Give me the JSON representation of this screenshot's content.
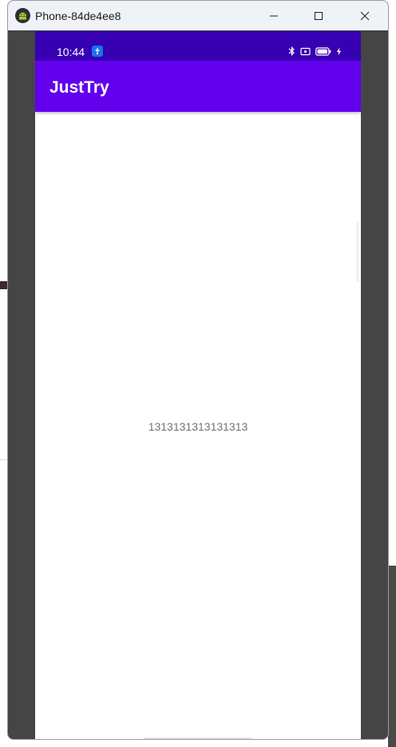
{
  "window": {
    "title": "Phone-84de4ee8",
    "buttons": [
      "minimize",
      "maximize",
      "close"
    ]
  },
  "statusbar": {
    "time": "10:44",
    "icons": [
      "notification-icon",
      "bluetooth-icon",
      "screen-icon",
      "battery-icon",
      "charging-icon"
    ]
  },
  "appbar": {
    "title": "JustTry"
  },
  "main": {
    "text": "1313131313131313"
  },
  "colors": {
    "statusbar": "#3700b3",
    "appbar": "#6200ee",
    "window_frame": "#454545",
    "text": "#737373"
  }
}
